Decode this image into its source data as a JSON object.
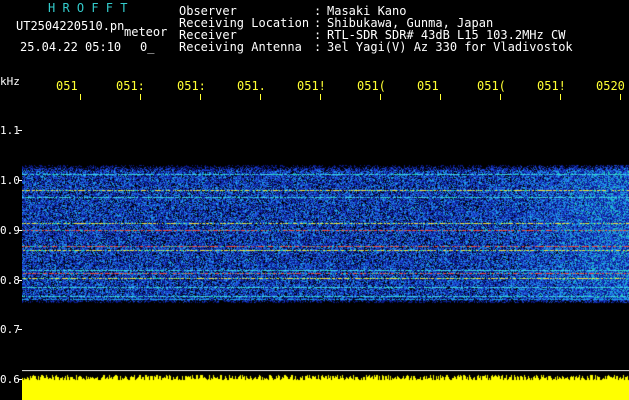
{
  "header": {
    "title": "H R O F F T",
    "filename": "UT2504220510.pn",
    "tag": "meteor",
    "date": "25.04.22 05:10",
    "counter": "0_"
  },
  "info": {
    "labels": [
      "Observer",
      "Receiving Location",
      "Receiver",
      "Receiving Antenna"
    ],
    "separator": ":",
    "values": [
      "Masaki Kano",
      "Shibukawa, Gunma, Japan",
      "RTL-SDR SDR# 43dB L15 103.2MHz CW",
      "3el Yagi(V) Az 330 for Vladivostok"
    ]
  },
  "axes": {
    "yunit": "kHz",
    "yticks": [
      "1.1",
      "1.0",
      "0.9",
      "0.8",
      "0.7",
      "0.6"
    ],
    "xticks": [
      "051",
      "051:",
      "051:",
      "051.",
      "051!",
      "051(",
      "051",
      "051(",
      "051!",
      "0520"
    ]
  },
  "colors": {
    "background": "#000000",
    "title": "#33cccc",
    "text": "#ffffff",
    "xaxis": "#ffff33",
    "baseline": "#ffff00"
  }
}
